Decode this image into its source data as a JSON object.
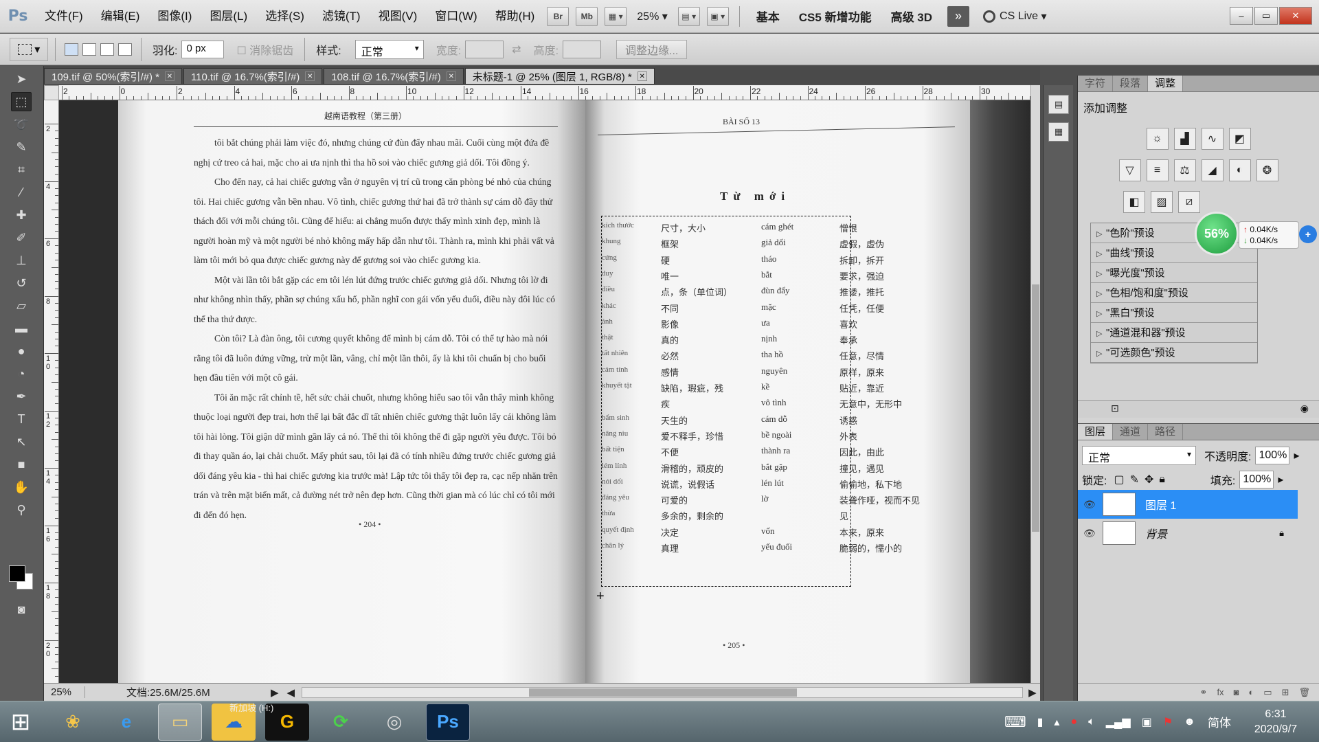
{
  "app": {
    "logo": "Ps",
    "window_controls": {
      "minimize": "–",
      "restore": "▭",
      "close": "✕"
    }
  },
  "menu": [
    "文件(F)",
    "编辑(E)",
    "图像(I)",
    "图层(L)",
    "选择(S)",
    "滤镜(T)",
    "视图(V)",
    "窗口(W)",
    "帮助(H)"
  ],
  "appbar": {
    "bridge": "Br",
    "mini_bridge": "Mb",
    "zoom": "25%",
    "workspaces": [
      "基本",
      "CS5 新增功能",
      "高级 3D"
    ],
    "more": "»",
    "cs_live": "CS Live"
  },
  "options": {
    "feather_label": "羽化:",
    "feather_value": "0 px",
    "antialias_label": "消除锯齿",
    "style_label": "样式:",
    "style_value": "正常",
    "width_label": "宽度:",
    "height_label": "高度:",
    "refine_edge": "调整边缘..."
  },
  "tools": [
    "move-icon",
    "marquee-icon",
    "lasso-icon",
    "quick-select-icon",
    "crop-icon",
    "eyedropper-icon",
    "healing-icon",
    "brush-icon",
    "stamp-icon",
    "history-brush-icon",
    "eraser-icon",
    "gradient-icon",
    "blur-icon",
    "dodge-icon",
    "pen-icon",
    "type-icon",
    "path-select-icon",
    "shape-icon",
    "hand-icon",
    "zoom-icon"
  ],
  "tabs": [
    {
      "label": "109.tif @ 50%(索引/#) *",
      "active": false
    },
    {
      "label": "110.tif @ 16.7%(索引/#)",
      "active": false
    },
    {
      "label": "108.tif @ 16.7%(索引/#)",
      "active": false
    },
    {
      "label": "未标题-1 @ 25% (图层 1, RGB/8) *",
      "active": true
    }
  ],
  "ruler_top": [
    "2",
    "0",
    "2",
    "4",
    "6",
    "8",
    "10",
    "12",
    "14",
    "16",
    "18",
    "20",
    "22",
    "24",
    "26",
    "28",
    "30"
  ],
  "ruler_left": [
    "2",
    "4",
    "6",
    "8",
    "1 0",
    "1 2",
    "1 4",
    "1 6",
    "1 8",
    "2 0"
  ],
  "book": {
    "left_header": "越南语教程（第三册）",
    "right_header": "BÀI SỐ 13",
    "vocab_title": "Từ mới",
    "left_page_num": "• 204 •",
    "right_page_num": "• 205 •",
    "paragraphs": [
      "tôi bắt chúng phải làm việc đó, nhưng chúng cứ đùn đẩy nhau mãi. Cuối cùng một đứa đề nghị cứ treo cả hai, mặc cho ai ưa nịnh thì tha hồ soi vào chiếc gương giả dối. Tôi đồng ý.",
      "Cho đến nay, cả hai chiếc gương vẫn ở nguyên vị trí cũ trong căn phòng bé nhỏ của chúng tôi. Hai chiếc gương vẫn bền nhau. Vô tình, chiếc gương thứ hai đã trở thành sự cám dỗ đầy thử thách đối với mỗi chúng tôi. Cũng để hiểu: ai chẳng muốn được thấy mình xinh đẹp, mình là người hoàn mỹ và một người bé nhỏ không mấy hấp dẫn như tôi. Thành ra, mình khi phải vất vả làm tôi mới bỏ qua được chiếc gương này để gương soi vào chiếc gương kia.",
      "Một vài lần tôi bắt gặp các em tôi lén lút đứng trước chiếc gương giả dối. Nhưng tôi lờ đi như không nhìn thấy, phần sợ chúng xấu hổ, phần nghĩ con gái vốn yếu đuối, điều này đôi lúc có thể tha thứ được.",
      "Còn tôi? Là đàn ông, tôi cương quyết không để mình bị cám dỗ. Tôi có thể tự hào mà nói rằng tôi đã luôn đứng vững, trừ một lần, vâng, chỉ một lần thôi, ấy là khi tôi chuẩn bị cho buổi hẹn đầu tiên với một cô gái.",
      "Tôi ăn mặc rất chỉnh tề, hết sức chải chuốt, nhưng không hiểu sao tôi vẫn thấy mình không thuộc loại người đẹp trai, hơn thế lại bất đắc dĩ tất nhiên chiếc gương thật luôn lấy cái không làm tôi hài lòng. Tôi giận dữ mình gần lấy cả nó. Thế thì tôi không thể đi gặp người yêu được. Tôi bỏ đi thay quần áo, lại chải chuốt. Mấy phút sau, tôi lại đã có tính nhiều đứng trước chiếc gương giả dối đáng yêu kia - thì hai chiếc gương kia trước mà! Lập tức tôi thấy tôi đẹp ra, cạc nếp nhăn trên trán và trên mặt biến mất, cả đường nét trở nên đẹp hơn. Cũng thời gian mà có lúc chỉ có tôi mới đi đến đó hẹn."
    ],
    "vocab": [
      {
        "l": "kích thước",
        "a": "尺寸，大小",
        "b": "cám ghét",
        "c": "憎恨"
      },
      {
        "l": "khung",
        "a": "框架",
        "b": "giả dối",
        "c": "虚假，虚伪"
      },
      {
        "l": "cứng",
        "a": "硬",
        "b": "tháo",
        "c": "拆卸，拆开"
      },
      {
        "l": "duy",
        "a": "唯一",
        "b": "bắt",
        "c": "要求，强迫"
      },
      {
        "l": "điều",
        "a": "点，条（单位词）",
        "b": "đùn đẩy",
        "c": "推诿，推托"
      },
      {
        "l": "khác",
        "a": "不同",
        "b": "mặc",
        "c": "任凭，任便"
      },
      {
        "l": "ảnh",
        "a": "影像",
        "b": "ưa",
        "c": "喜欢"
      },
      {
        "l": "thật",
        "a": "真的",
        "b": "nịnh",
        "c": "奉承"
      },
      {
        "l": "tất nhiên",
        "a": "必然",
        "b": "tha hồ",
        "c": "任意，尽情"
      },
      {
        "l": "cảm tính",
        "a": "感情",
        "b": "nguyên",
        "c": "原样，原来"
      },
      {
        "l": "khuyết tật",
        "a": "缺陷，瑕疵，残",
        "b": "kề",
        "c": "贴近，靠近"
      },
      {
        "l": "",
        "a": "疾",
        "b": "vô tình",
        "c": "无意中，无形中"
      },
      {
        "l": "bẩm sinh",
        "a": "天生的",
        "b": "cám dỗ",
        "c": "诱惑"
      },
      {
        "l": "nâng niu",
        "a": "爱不释手，珍惜",
        "b": "bề ngoài",
        "c": "外表"
      },
      {
        "l": "bất tiện",
        "a": "不便",
        "b": "thành ra",
        "c": "因此，由此"
      },
      {
        "l": "lém lỉnh",
        "a": "滑稽的，顽皮的",
        "b": "bắt gặp",
        "c": "撞见，遇见"
      },
      {
        "l": "nói dối",
        "a": "说谎，说假话",
        "b": "lén lút",
        "c": "偷偷地，私下地"
      },
      {
        "l": "đáng yêu",
        "a": "可爱的",
        "b": "lờ",
        "c": "装聋作哑，视而不见"
      },
      {
        "l": "thừa",
        "a": "多余的，剩余的",
        "b": "",
        "c": "见"
      },
      {
        "l": "quyết định",
        "a": "决定",
        "b": "vốn",
        "c": "本来，原来"
      },
      {
        "l": "chân lý",
        "a": "真理",
        "b": "yếu đuối",
        "c": "脆弱的，懦小的"
      }
    ]
  },
  "status": {
    "zoom": "25%",
    "doc": "文档:25.6M/25.6M",
    "scroll_left": "◀",
    "scroll_right": "▶"
  },
  "panel": {
    "tabs": [
      "字符",
      "段落",
      "调整"
    ],
    "active_tab": 2,
    "title": "添加调整",
    "presets": [
      "\"色阶\"预设",
      "\"曲线\"预设",
      "\"曝光度\"预设",
      "\"色相/饱和度\"预设",
      "\"黑白\"预设",
      "\"通道混和器\"预设",
      "\"可选颜色\"预设"
    ],
    "net": {
      "percent": "56%",
      "up": "0.04K/s",
      "down": "0.04K/s",
      "plus": "+"
    }
  },
  "layers": {
    "tabs": [
      "图层",
      "通道",
      "路径"
    ],
    "blend": "正常",
    "opacity_label": "不透明度:",
    "opacity": "100%",
    "lock_label": "锁定:",
    "fill_label": "填充:",
    "fill": "100%",
    "items": [
      {
        "name": "图层 1",
        "selected": true
      },
      {
        "name": "背景",
        "selected": false
      }
    ]
  },
  "taskbar": {
    "apps": [
      "start-icon",
      "app-icon",
      "ie-icon",
      "explorer-icon",
      "cloud-icon",
      "g-icon",
      "update-icon",
      "ball-icon",
      "ps-icon"
    ],
    "explorer_label": "新加坡 (H:)",
    "ps_label": "Ps",
    "ime": "简体",
    "time": "6:31",
    "date": "2020/9/7"
  }
}
